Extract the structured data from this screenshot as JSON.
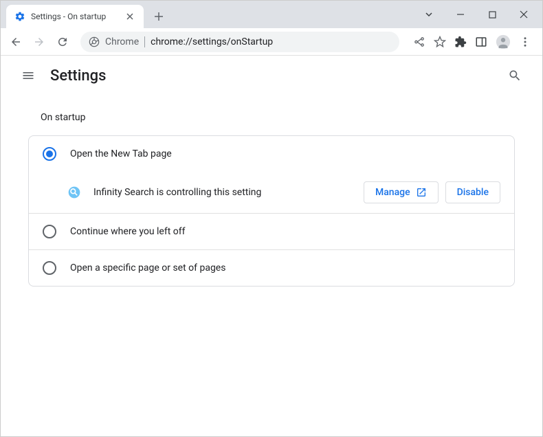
{
  "tab": {
    "title": "Settings - On startup"
  },
  "omnibox": {
    "prefix": "Chrome",
    "url": "chrome://settings/onStartup"
  },
  "header": {
    "title": "Settings"
  },
  "section": {
    "title": "On startup"
  },
  "options": {
    "newTab": "Open the New Tab page",
    "continue": "Continue where you left off",
    "specific": "Open a specific page or set of pages"
  },
  "extension": {
    "message": "Infinity Search is controlling this setting",
    "manageLabel": "Manage",
    "disableLabel": "Disable"
  }
}
